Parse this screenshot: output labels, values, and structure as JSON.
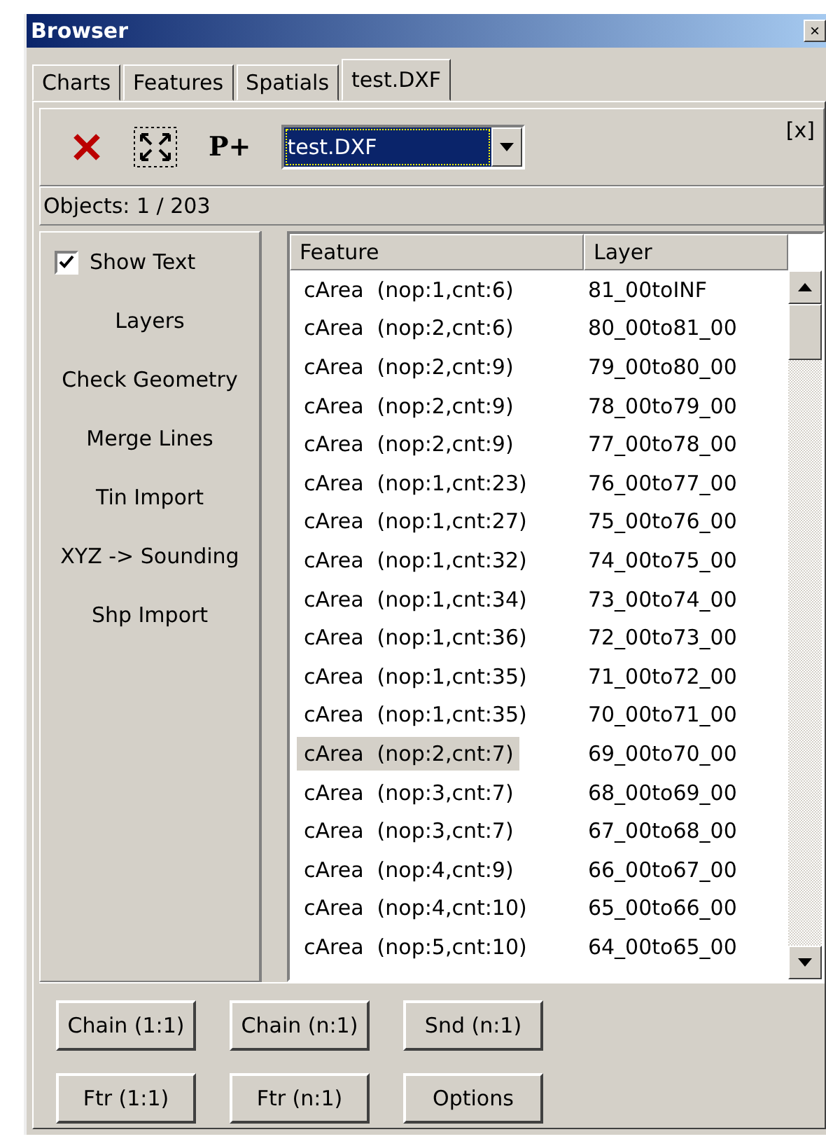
{
  "window": {
    "title": "Browser",
    "close": "×"
  },
  "tabs": [
    {
      "label": "Charts",
      "selected": false
    },
    {
      "label": "Features",
      "selected": false
    },
    {
      "label": "Spatials",
      "selected": false
    },
    {
      "label": "test.DXF",
      "selected": true
    }
  ],
  "toolbar": {
    "plus": "P+",
    "file": "test.DXF",
    "dismiss": "[x]"
  },
  "objects": "Objects: 1 / 203",
  "sidebar": {
    "show_text": {
      "label": "Show Text",
      "checked": true
    },
    "items": [
      "Layers",
      "Check Geometry",
      "Merge Lines",
      "Tin Import",
      "XYZ -> Sounding",
      "Shp Import"
    ]
  },
  "table": {
    "columns": [
      "Feature",
      "Layer"
    ],
    "rows": [
      {
        "feature": "cArea  (nop:1,cnt:6)",
        "layer": "81_00toINF",
        "selected": false
      },
      {
        "feature": "cArea  (nop:2,cnt:6)",
        "layer": "80_00to81_00",
        "selected": false
      },
      {
        "feature": "cArea  (nop:2,cnt:9)",
        "layer": "79_00to80_00",
        "selected": false
      },
      {
        "feature": "cArea  (nop:2,cnt:9)",
        "layer": "78_00to79_00",
        "selected": false
      },
      {
        "feature": "cArea  (nop:2,cnt:9)",
        "layer": "77_00to78_00",
        "selected": false
      },
      {
        "feature": "cArea  (nop:1,cnt:23)",
        "layer": "76_00to77_00",
        "selected": false
      },
      {
        "feature": "cArea  (nop:1,cnt:27)",
        "layer": "75_00to76_00",
        "selected": false
      },
      {
        "feature": "cArea  (nop:1,cnt:32)",
        "layer": "74_00to75_00",
        "selected": false
      },
      {
        "feature": "cArea  (nop:1,cnt:34)",
        "layer": "73_00to74_00",
        "selected": false
      },
      {
        "feature": "cArea  (nop:1,cnt:36)",
        "layer": "72_00to73_00",
        "selected": false
      },
      {
        "feature": "cArea  (nop:1,cnt:35)",
        "layer": "71_00to72_00",
        "selected": false
      },
      {
        "feature": "cArea  (nop:1,cnt:35)",
        "layer": "70_00to71_00",
        "selected": false
      },
      {
        "feature": "cArea  (nop:2,cnt:7)",
        "layer": "69_00to70_00",
        "selected": true
      },
      {
        "feature": "cArea  (nop:3,cnt:7)",
        "layer": "68_00to69_00",
        "selected": false
      },
      {
        "feature": "cArea  (nop:3,cnt:7)",
        "layer": "67_00to68_00",
        "selected": false
      },
      {
        "feature": "cArea  (nop:4,cnt:9)",
        "layer": "66_00to67_00",
        "selected": false
      },
      {
        "feature": "cArea  (nop:4,cnt:10)",
        "layer": "65_00to66_00",
        "selected": false
      },
      {
        "feature": "cArea  (nop:5,cnt:10)",
        "layer": "64_00to65_00",
        "selected": false
      }
    ]
  },
  "buttons": [
    [
      "Chain (1:1)",
      "Chain (n:1)",
      "Snd (n:1)"
    ],
    [
      "Ftr (1:1)",
      "Ftr (n:1)",
      "Options"
    ]
  ]
}
